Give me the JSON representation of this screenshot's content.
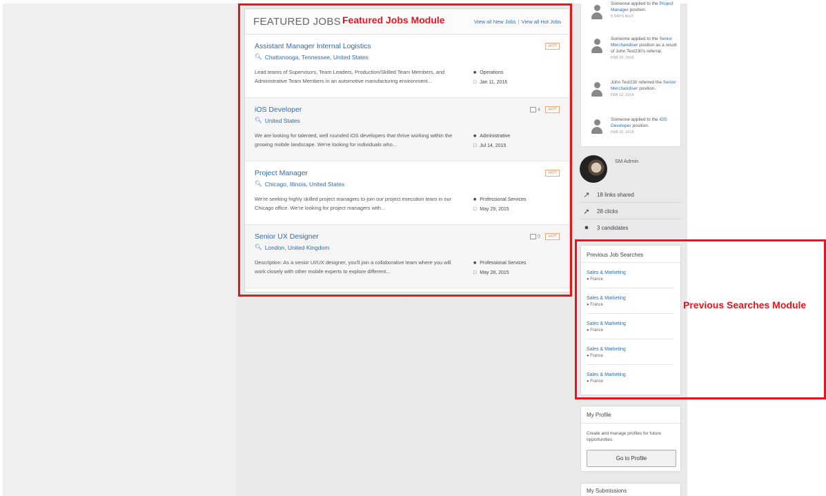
{
  "annotations": {
    "featured_label": "Featured Jobs Module",
    "previous_label": "Previous Searches Module"
  },
  "colors": {
    "accent": "#e8141c",
    "link": "#2b6cb0",
    "hot": "#e07a3a"
  },
  "featured": {
    "title": "FEATURED JOBS",
    "view_new": "View all New Jobs",
    "separator": "|",
    "view_hot": "View all Hot Jobs",
    "jobs": [
      {
        "title": "Assistant Manager Internal Logistics",
        "location": "Chattanooga, Tennessee, United States",
        "description": "Lead teams of Supervisors, Team Leaders, Production/Skilled Team Members, and Administrative Team Members in an automotive manufacturing environment...",
        "category": "Operations",
        "date": "Jan 11, 2016",
        "badge": "HOT",
        "compare": ""
      },
      {
        "title": "iOS Developer",
        "location": "United States",
        "description": "We are looking for talented, well rounded iOS developers that thrive working within the growing mobile landscape. We're looking for individuals who...",
        "category": "Administrative",
        "date": "Jul 14, 2015",
        "badge": "HOT",
        "compare": "4"
      },
      {
        "title": "Project Manager",
        "location": "Chicago, Illinois, United States",
        "description": "We're seeking highly skilled project managers to join our project execution team in our Chicago office. We're looking for project managers with...",
        "category": "Professional Services",
        "date": "May 29, 2015",
        "badge": "HOT",
        "compare": ""
      },
      {
        "title": "Senior UX Designer",
        "location": "London, United Kingdom",
        "description": "Description: As a senior UI/UX designer, you'll join a collaborative team where you will work closely with other mobile experts to explore different...",
        "category": "Professional Services",
        "date": "May 28, 2015",
        "badge": "HOT",
        "compare": "0"
      }
    ]
  },
  "activity": {
    "items": [
      {
        "pre": "Someone applied to the",
        "link": "Project Manager",
        "post": "position.",
        "date": "8 DAYS AGO"
      },
      {
        "pre": "Someone applied to the",
        "link": "Senior Merchandiser",
        "post": "position as a result of John Test230's referral.",
        "date": "FEB 15, 2016"
      },
      {
        "pre": "John Test230 referred the",
        "link": "Senior Merchandiser",
        "post": "position.",
        "date": "FEB 12, 2016"
      },
      {
        "pre": "Someone applied to the",
        "link": "iOS Developer",
        "post": "position.",
        "date": "FEB 10, 2016"
      }
    ]
  },
  "profile": {
    "name": "SM Admin",
    "links_shared": "18 links shared",
    "clicks": "28 clicks",
    "candidates": "3 candidates"
  },
  "previous_searches": {
    "title": "Previous Job Searches",
    "items": [
      {
        "title": "Sales & Marketing",
        "location": "France"
      },
      {
        "title": "Sales & Marketing",
        "location": "France"
      },
      {
        "title": "Sales & Marketing",
        "location": "France"
      },
      {
        "title": "Sales & Marketing",
        "location": "France"
      },
      {
        "title": "Sales & Marketing",
        "location": "France"
      }
    ]
  },
  "my_profile": {
    "title": "My Profile",
    "text": "Create and manage profiles for future opportunities.",
    "button": "Go to Profile"
  },
  "my_submissions": {
    "title": "My Submissions"
  }
}
